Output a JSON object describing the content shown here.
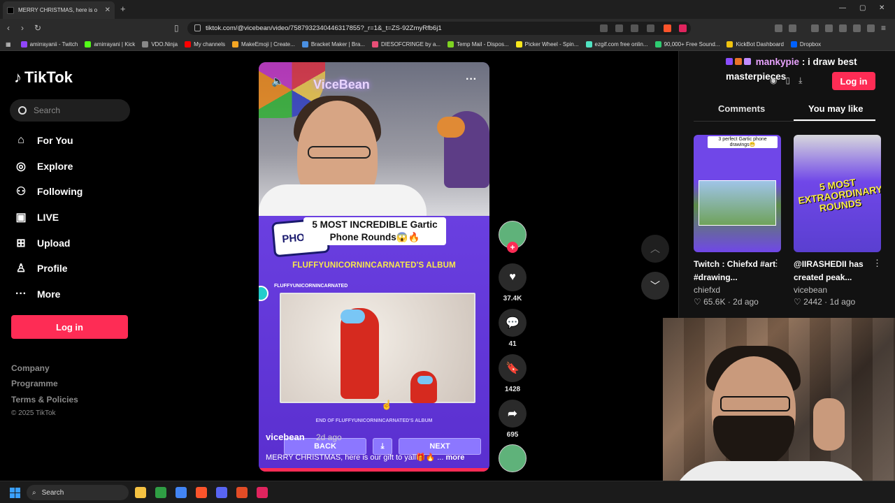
{
  "browser": {
    "tab_title": "MERRY CHRISTMAS, here is o",
    "new_tab": "+",
    "tab_close": "✕",
    "url": "tiktok.com/@vicebean/video/7587932340446317855?_r=1&_t=ZS-92ZmyRfb6j1",
    "bookmarks": [
      "amirrayanii - Twitch",
      "amirrayani | Kick",
      "VDO.Ninja",
      "My channels",
      "MakeEmoji | Create...",
      "Bracket Maker | Bra...",
      "DIESOFCRINGE by a...",
      "Temp Mail - Dispos...",
      "Picker Wheel - Spin...",
      "ezgif.com free onlin...",
      "90,000+ Free Sound...",
      "KickBot Dashboard",
      "Dropbox"
    ],
    "bookmark_colors": [
      "#9146ff",
      "#53fc18",
      "#888888",
      "#ff0000",
      "#f5a623",
      "#4a90e2",
      "#e94e77",
      "#7ed321",
      "#f8e71c",
      "#50e3c2",
      "#2ecc71",
      "#f1c40f",
      "#0061ff"
    ]
  },
  "sidebar": {
    "logo": "TikTok",
    "search_placeholder": "Search",
    "nav": [
      {
        "label": "For You",
        "icon": "home-icon"
      },
      {
        "label": "Explore",
        "icon": "compass-icon"
      },
      {
        "label": "Following",
        "icon": "following-icon"
      },
      {
        "label": "LIVE",
        "icon": "live-tv-icon"
      },
      {
        "label": "Upload",
        "icon": "upload-icon"
      },
      {
        "label": "Profile",
        "icon": "profile-icon"
      },
      {
        "label": "More",
        "icon": "more-dots-icon"
      }
    ],
    "login": "Log in",
    "footer": [
      "Company",
      "Programme",
      "Terms & Policies"
    ],
    "copyright": "© 2025 TikTok"
  },
  "video": {
    "neon_text": "ViceBean",
    "gartic_logo": "PHONE",
    "banner": "5 MOST INCREDIBLE Gartic Phone Rounds😱🔥",
    "album_title": "FLUFFYUNICORNINCARNATED'S ALBUM",
    "album_user": "FLUFFYUNICORNINCARNATED",
    "end_album": "END OF FLUFFYUNICORNINCARNATED'S ALBUM",
    "back": "BACK",
    "next": "NEXT",
    "author": "vicebean",
    "date": "2d ago",
    "caption": "MERRY CHRISTMAS, here is our gift to yall🎁🔥 ...",
    "more": "more"
  },
  "actions": {
    "likes": "37.4K",
    "comments": "41",
    "saves": "1428",
    "shares": "695"
  },
  "right_panel": {
    "chat_user": "mankypie",
    "chat_message": ": i draw best masterpieces",
    "login": "Log in",
    "tabs": [
      "Comments",
      "You may like"
    ],
    "t1_text": "3 perfect Gartic phone drawings😁",
    "t2_text": "5 MOST EXTRAORDINARY ROUNDS",
    "items": [
      {
        "title": "Twitch : Chiefxd #art #drawing...",
        "author": "chiefxd",
        "likes": "65.6K",
        "date": "2d ago"
      },
      {
        "title": "@IIRASHEDII has created peak...",
        "author": "vicebean",
        "likes": "2442",
        "date": "1d ago"
      }
    ]
  },
  "taskbar": {
    "search": "Search",
    "app_colors": [
      "#f5c242",
      "#2f9e44",
      "#4285f4",
      "#fb542b",
      "#5865f2",
      "#e34c26",
      "#e0245e"
    ]
  }
}
